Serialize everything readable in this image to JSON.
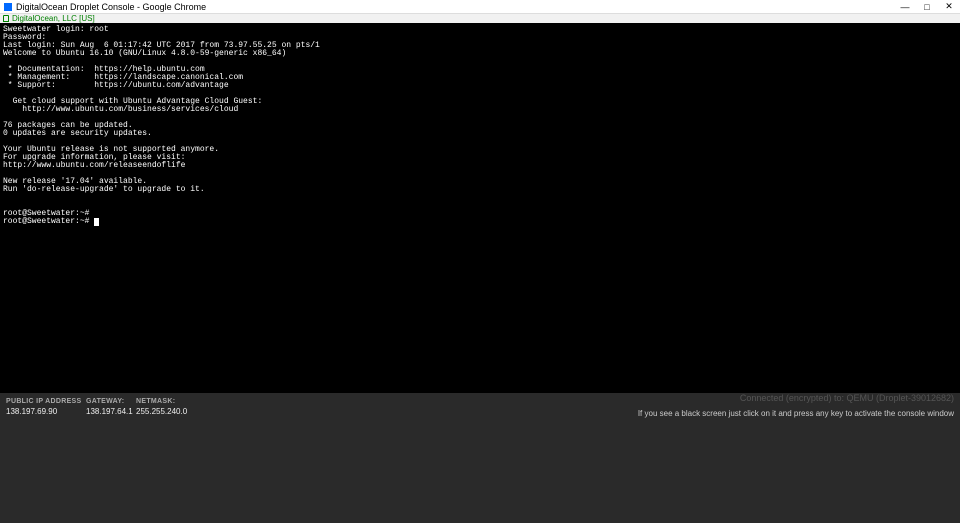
{
  "window": {
    "title": "DigitalOcean Droplet Console - Google Chrome"
  },
  "addressbar": {
    "identity": "DigitalOcean, LLC [US]"
  },
  "terminal": {
    "lines": [
      "Sweetwater login: root",
      "Password:",
      "Last login: Sun Aug  6 01:17:42 UTC 2017 from 73.97.55.25 on pts/1",
      "Welcome to Ubuntu 16.10 (GNU/Linux 4.8.0-59-generic x86_64)",
      "",
      " * Documentation:  https://help.ubuntu.com",
      " * Management:     https://landscape.canonical.com",
      " * Support:        https://ubuntu.com/advantage",
      "",
      "  Get cloud support with Ubuntu Advantage Cloud Guest:",
      "    http://www.ubuntu.com/business/services/cloud",
      "",
      "76 packages can be updated.",
      "0 updates are security updates.",
      "",
      "Your Ubuntu release is not supported anymore.",
      "For upgrade information, please visit:",
      "http://www.ubuntu.com/releaseendoflife",
      "",
      "New release '17.04' available.",
      "Run 'do-release-upgrade' to upgrade to it.",
      "",
      "",
      "root@Sweetwater:~#",
      "root@Sweetwater:~# "
    ]
  },
  "status": {
    "connected": "Connected (encrypted) to: QEMU (Droplet-39012682)",
    "public_ip_label": "PUBLIC IP ADDRESS",
    "public_ip": "138.197.69.90",
    "gateway_label": "GATEWAY:",
    "gateway": "138.197.64.1",
    "netmask_label": "NETMASK:",
    "netmask": "255.255.240.0",
    "hint": "If you see a black screen just click on it and press any key to activate the console window"
  }
}
